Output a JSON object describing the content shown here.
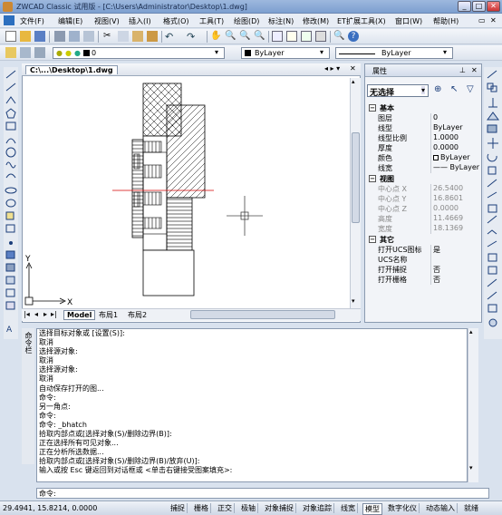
{
  "title": "ZWCAD Classic 试用版 - [C:\\Users\\Administrator\\Desktop\\1.dwg]",
  "menu": [
    "文件(F)",
    "编辑(E)",
    "视图(V)",
    "插入(I)",
    "格式(O)",
    "工具(T)",
    "绘图(D)",
    "标注(N)",
    "修改(M)",
    "ET扩展工具(X)",
    "窗口(W)",
    "帮助(H)"
  ],
  "layer_toolbar": {
    "layer": "0",
    "color": "ByLayer",
    "linetype": "ByLayer"
  },
  "doc_tab": "C:\\...\\Desktop\\1.dwg",
  "layout_tabs": [
    "Model",
    "布局1",
    "布局2"
  ],
  "ucs": {
    "x": "X",
    "y": "Y"
  },
  "props": {
    "title": "属性",
    "selection": "无选择",
    "sections": {
      "basic": "基本",
      "view": "视图",
      "other": "其它"
    },
    "basic": [
      [
        "图层",
        "0"
      ],
      [
        "线型",
        "ByLayer"
      ],
      [
        "线型比例",
        "1.0000"
      ],
      [
        "厚度",
        "0.0000"
      ],
      [
        "颜色",
        "ByLayer"
      ],
      [
        "线宽",
        "—— ByLayer"
      ]
    ],
    "view": [
      [
        "中心点 X",
        "26.5400"
      ],
      [
        "中心点 Y",
        "16.8601"
      ],
      [
        "中心点 Z",
        "0.0000"
      ],
      [
        "高度",
        "11.4669"
      ],
      [
        "宽度",
        "18.1369"
      ]
    ],
    "other": [
      [
        "打开UCS图标",
        "是"
      ],
      [
        "UCS名称",
        ""
      ],
      [
        "打开捕捉",
        "否"
      ],
      [
        "打开栅格",
        "否"
      ]
    ]
  },
  "cmd_side": "命令栏",
  "cmd_lines": [
    "选择目标对象或 [设置(S)]:",
    "取消",
    "选择源对象:",
    "取消",
    "选择源对象:",
    "取消",
    "自动保存打开的图...",
    "命令:",
    "另一角点:",
    "命令:",
    "命令: _bhatch",
    "拾取内部点或[选择对象(S)/删除边界(B)]:",
    "正在选择所有可见对象...",
    "正在分析所选数据...",
    "拾取内部点或[选择对象(S)/删除边界(B)/放弃(U)]:",
    "输入或按 Esc 键返回到对话框或 <单击右键接受图案填充>:"
  ],
  "cmd_prompt": "命令:",
  "status": {
    "coords": "29.4941,  15.8214,  0.0000",
    "buttons": [
      "捕捉",
      "栅格",
      "正交",
      "极轴",
      "对象捕捉",
      "对象追踪",
      "线宽",
      "模型",
      "数字化仪",
      "动态输入",
      "就绪"
    ]
  }
}
